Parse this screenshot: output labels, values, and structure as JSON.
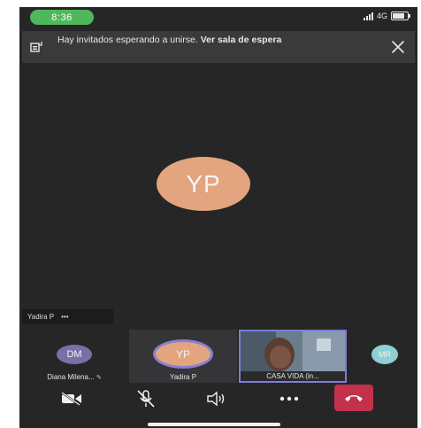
{
  "status_bar": {
    "time": "8:36",
    "network": "4G"
  },
  "banner": {
    "message": "Hay invitados esperando a unirse.",
    "link_label": "Ver sala de espera",
    "icon": "lobby-icon",
    "close_icon": "close-icon"
  },
  "main_participant": {
    "initials": "YP",
    "color": "#e2a57f"
  },
  "speaker_tag": {
    "name": "Yadira P",
    "more_label": "•••"
  },
  "participants": [
    {
      "initials": "DM",
      "name": "Diana Milena...",
      "color": "#7b6fa8"
    },
    {
      "initials": "YP",
      "name": "Yadira P",
      "color": "#e2a57f"
    },
    {
      "name": "CASA VIDA (in..."
    },
    {
      "initials": "MR",
      "color": "#8ecfd3"
    }
  ],
  "controls": {
    "camera_icon": "camera-off-icon",
    "mic_icon": "mic-muted-icon",
    "speaker_icon": "speaker-icon",
    "more_icon": "more-icon",
    "hangup_icon": "hangup-icon",
    "hangup_color": "#c4314b"
  }
}
